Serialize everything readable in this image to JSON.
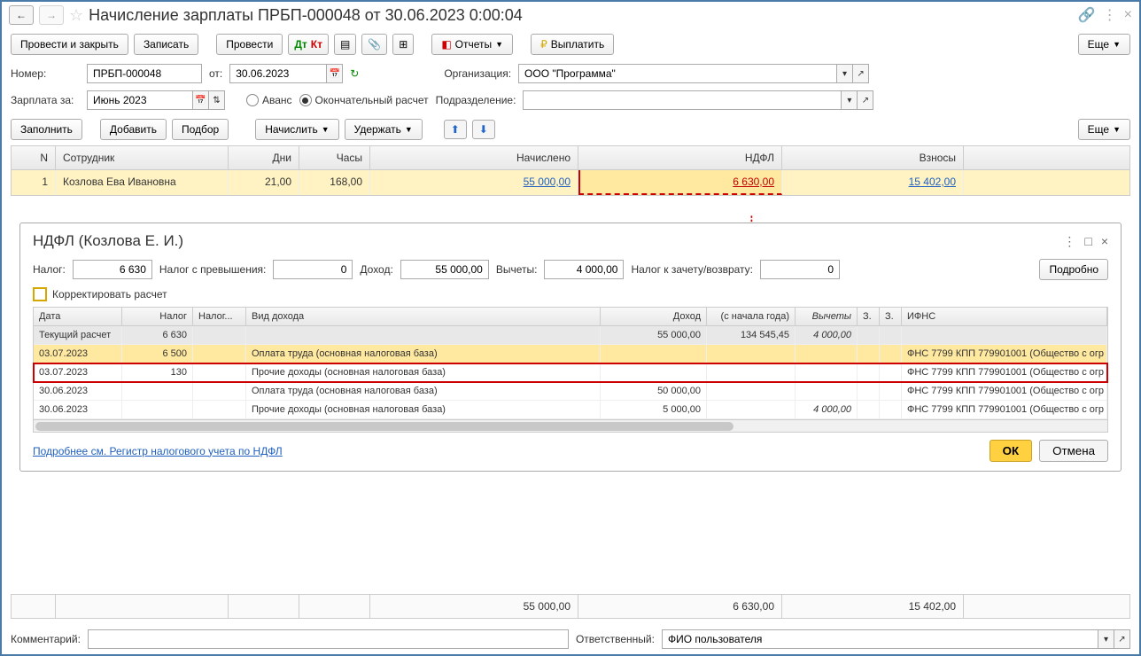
{
  "title": "Начисление зарплаты ПРБП-000048 от 30.06.2023 0:00:04",
  "toolbar": {
    "post_close": "Провести и закрыть",
    "save": "Записать",
    "post": "Провести",
    "reports": "Отчеты",
    "pay": "Выплатить",
    "more": "Еще"
  },
  "form": {
    "number_label": "Номер:",
    "number": "ПРБП-000048",
    "from_label": "от:",
    "date": "30.06.2023",
    "org_label": "Организация:",
    "org": "ООО \"Программа\"",
    "salary_for_label": "Зарплата за:",
    "period": "Июнь 2023",
    "advance": "Аванс",
    "final": "Окончательный расчет",
    "dept_label": "Подразделение:"
  },
  "actions": {
    "fill": "Заполнить",
    "add": "Добавить",
    "pick": "Подбор",
    "accrue": "Начислить",
    "withhold": "Удержать"
  },
  "main_table": {
    "headers": {
      "n": "N",
      "emp": "Сотрудник",
      "days": "Дни",
      "hours": "Часы",
      "accr": "Начислено",
      "ndfl": "НДФЛ",
      "contr": "Взносы"
    },
    "row": {
      "n": "1",
      "emp": "Козлова Ева Ивановна",
      "days": "21,00",
      "hours": "168,00",
      "accr": "55 000,00",
      "ndfl": "6 630,00",
      "contr": "15 402,00"
    }
  },
  "detail": {
    "title": "НДФЛ (Козлова Е. И.)",
    "tax_label": "Налог:",
    "tax": "6 630",
    "excess_label": "Налог с превышения:",
    "excess": "0",
    "income_label": "Доход:",
    "income": "55 000,00",
    "ded_label": "Вычеты:",
    "ded": "4 000,00",
    "credit_label": "Налог к зачету/возврату:",
    "credit": "0",
    "more_btn": "Подробно",
    "correct_label": "Корректировать расчет",
    "headers": {
      "date": "Дата",
      "tax": "Налог",
      "tax2": "Налог...",
      "type": "Вид дохода",
      "income": "Доход",
      "ytd": "(с начала года)",
      "ded": "Вычеты",
      "c1": "З.",
      "c2": "З.",
      "ifns": "ИФНС"
    },
    "rows": [
      {
        "date": "Текущий расчет",
        "tax": "6 630",
        "type": "",
        "income": "55 000,00",
        "ytd": "134 545,45",
        "ded": "4 000,00",
        "ifns": "",
        "cls": "summary"
      },
      {
        "date": "03.07.2023",
        "tax": "6 500",
        "type": "Оплата труда (основная налоговая база)",
        "income": "",
        "ytd": "",
        "ded": "",
        "ifns": "ФНС 7799 КПП 779901001 (Общество с огр",
        "cls": "yel"
      },
      {
        "date": "03.07.2023",
        "tax": "130",
        "type": "Прочие доходы (основная налоговая база)",
        "income": "",
        "ytd": "",
        "ded": "",
        "ifns": "ФНС 7799 КПП 779901001 (Общество с огр",
        "cls": "redbox"
      },
      {
        "date": "30.06.2023",
        "tax": "",
        "type": "Оплата труда (основная налоговая база)",
        "income": "50 000,00",
        "ytd": "",
        "ded": "",
        "ifns": "ФНС 7799 КПП 779901001 (Общество с огр",
        "cls": ""
      },
      {
        "date": "30.06.2023",
        "tax": "",
        "type": "Прочие доходы (основная налоговая база)",
        "income": "5 000,00",
        "ytd": "",
        "ded": "4 000,00",
        "ifns": "ФНС 7799 КПП 779901001 (Общество с огр",
        "cls": ""
      }
    ],
    "link": "Подробнее см. Регистр налогового учета по НДФЛ",
    "ok": "ОК",
    "cancel": "Отмена"
  },
  "totals": {
    "accr": "55 000,00",
    "ndfl": "6 630,00",
    "contr": "15 402,00"
  },
  "bottom": {
    "comment_label": "Комментарий:",
    "resp_label": "Ответственный:",
    "resp": "ФИО пользователя"
  }
}
